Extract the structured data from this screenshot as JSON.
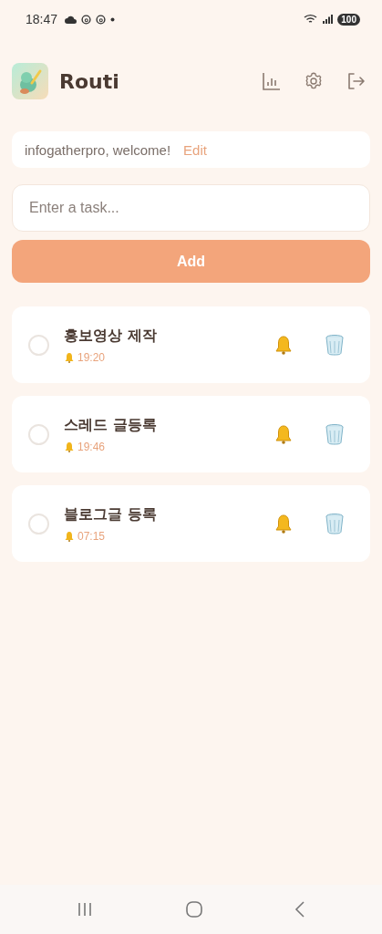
{
  "status_bar": {
    "time": "18:47",
    "battery": "100"
  },
  "header": {
    "title": "Routi"
  },
  "welcome": {
    "text": "infogatherpro, welcome!",
    "edit": "Edit"
  },
  "task_input": {
    "placeholder": "Enter a task..."
  },
  "add_button": "Add",
  "tasks": [
    {
      "title": "홍보영상 제작",
      "time": "19:20",
      "checked": false
    },
    {
      "title": "스레드 글등록",
      "time": "19:46",
      "checked": false
    },
    {
      "title": "블로그글 등록",
      "time": "07:15",
      "checked": false
    }
  ]
}
